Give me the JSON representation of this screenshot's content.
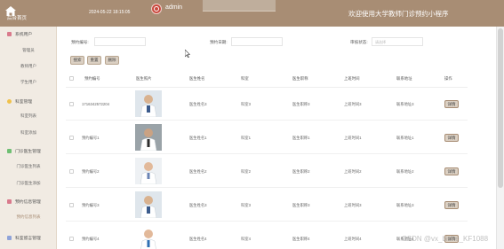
{
  "header": {
    "home_label": "后台首页",
    "datetime": "2024-05-22 18:15:05",
    "username": "admin",
    "title": "欢迎使用大学教师门诊预约小程序"
  },
  "sidebar": {
    "groups": [
      {
        "label": "系统用户",
        "icon": "users-icon",
        "color": "#d97a8c",
        "items": [
          "管理员",
          "教师用户",
          "学生用户"
        ]
      },
      {
        "label": "科室管理",
        "icon": "department-icon",
        "color": "#f0c14b",
        "items": [
          "科室列表",
          "科室添加"
        ]
      },
      {
        "label": "门诊医生管理",
        "icon": "doctor-icon",
        "color": "#6fbf73",
        "items": [
          "门诊医生列表",
          "门诊医生添加"
        ]
      },
      {
        "label": "预约信息管理",
        "icon": "calendar-icon",
        "color": "#d97a8c",
        "items": [
          "预约信息列表"
        ]
      },
      {
        "label": "科室留言管理",
        "icon": "message-icon",
        "color": "#8fa3d9",
        "items": []
      }
    ],
    "active_item": "预约信息列表"
  },
  "search": {
    "fields": [
      {
        "label": "预约编号:",
        "placeholder": ""
      },
      {
        "label": "预约日期:",
        "placeholder": ""
      }
    ],
    "status_label": "审核状态:",
    "status_placeholder": "请选择",
    "buttons": {
      "search": "搜索",
      "reset": "重置",
      "delete": "删除"
    }
  },
  "table": {
    "headers": [
      "预约编号",
      "医生照片",
      "医生姓名",
      "科室",
      "医生职称",
      "上班时间",
      "联系地址",
      "操作"
    ],
    "rows": [
      {
        "id": "1716342572204",
        "name": "医生姓名3",
        "dept": "科室3",
        "title": "医生职称3",
        "time": "上班时间3",
        "addr": "联系地址3",
        "action": "详情"
      },
      {
        "id": "预约编号1",
        "name": "医生姓名1",
        "dept": "科室1",
        "title": "医生职称1",
        "time": "上班时间1",
        "addr": "联系地址1",
        "action": "详情"
      },
      {
        "id": "预约编号2",
        "name": "医生姓名2",
        "dept": "科室2",
        "title": "医生职称2",
        "time": "上班时间2",
        "addr": "联系地址2",
        "action": "详情"
      },
      {
        "id": "预约编号3",
        "name": "医生姓名3",
        "dept": "科室3",
        "title": "医生职称3",
        "time": "上班时间3",
        "addr": "联系地址3",
        "action": "详情"
      },
      {
        "id": "预约编号4",
        "name": "医生姓名4",
        "dept": "科室4",
        "title": "医生职称4",
        "time": "上班时间4",
        "addr": "联系地址4",
        "action": "详情"
      }
    ]
  },
  "watermark": "CSDN @vx_bishe_KF1088",
  "colors": {
    "header": "#a88d74",
    "sidebar": "#f1ebe3",
    "button": "#dbd0c3"
  }
}
